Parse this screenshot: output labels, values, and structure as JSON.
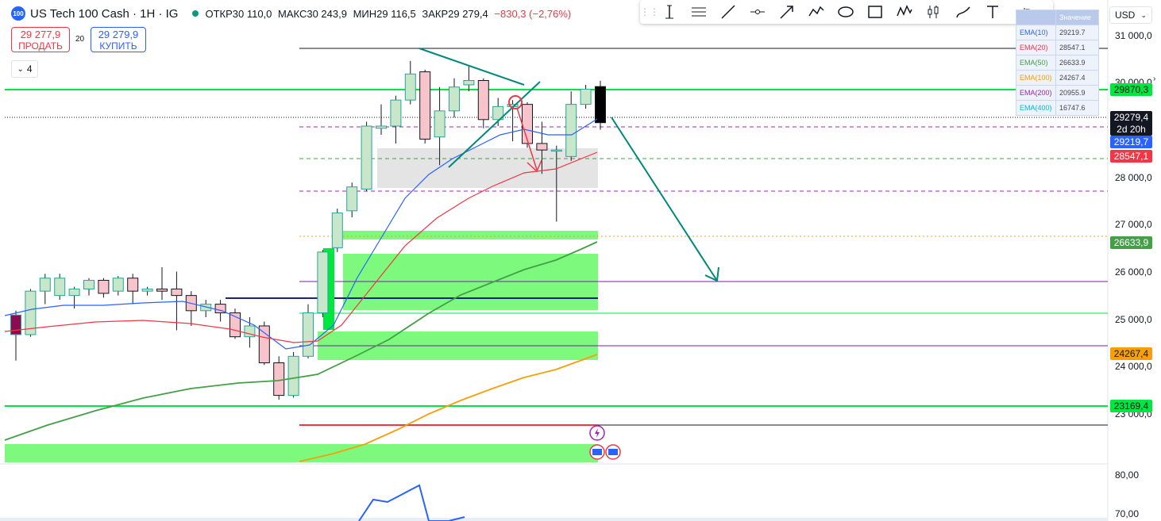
{
  "header": {
    "logo_text": "100",
    "symbol_title": "US Tech 100 Cash · 1H · IG",
    "open": "ОТКР30 110,0",
    "high": "МАКС30 243,9",
    "low": "МИН29 116,5",
    "close": "ЗАКР29 279,4",
    "change": "−830,3 (−2,76%)"
  },
  "trade": {
    "sell_price": "29 277,9",
    "sell_label": "ПРОДАТЬ",
    "spread": "20",
    "buy_price": "29 279,9",
    "buy_label": "КУПИТЬ"
  },
  "indicators_toggle": {
    "label": "4"
  },
  "currency": {
    "label": "USD"
  },
  "ema_table": {
    "header_right": "Значение",
    "rows": [
      {
        "name": "EMA(10)",
        "value": "29219.7",
        "color": "#2962ff"
      },
      {
        "name": "EMA(20)",
        "value": "28547.1",
        "color": "#f23645"
      },
      {
        "name": "EMA(50)",
        "value": "26633.9",
        "color": "#43a047"
      },
      {
        "name": "EMA(100)",
        "value": "24267.4",
        "color": "#f5a00a"
      },
      {
        "name": "EMA(200)",
        "value": "20955.9",
        "color": "#9c27b0"
      },
      {
        "name": "EMA(400)",
        "value": "16747.6",
        "color": "#00bcd4"
      }
    ]
  },
  "price_axis": {
    "labels": [
      "31 000,0",
      "30 000,0",
      "28 000,0",
      "27 000,0",
      "26 000,0",
      "25 000,0",
      "24 000,0",
      "23 000,0"
    ],
    "osc_labels": [
      "80,00",
      "70,00"
    ]
  },
  "price_tags": [
    {
      "text": "29870,3",
      "bg": "#00e640",
      "fg": "#131722"
    },
    {
      "text": "29279,4",
      "bg": "#131722",
      "fg": "#ffffff"
    },
    {
      "text": "2d 20h",
      "bg": "#131722",
      "fg": "#ffffff"
    },
    {
      "text": "29219,7",
      "bg": "#2962ff",
      "fg": "#ffffff"
    },
    {
      "text": "28547,1",
      "bg": "#f23645",
      "fg": "#ffffff"
    },
    {
      "text": "26633,9",
      "bg": "#43a047",
      "fg": "#ffffff"
    },
    {
      "text": "24267,4",
      "bg": "#f5a00a",
      "fg": "#131722"
    },
    {
      "text": "23169,4",
      "bg": "#00e640",
      "fg": "#131722"
    }
  ],
  "toolbar": {
    "tools": [
      "vertical-line-icon",
      "horizontal-lines-icon",
      "trend-line-icon",
      "horizontal-ray-icon",
      "arrow-icon",
      "polyline-icon",
      "ellipse-icon",
      "rectangle-icon",
      "pattern-icon",
      "fib-icon",
      "brush-icon",
      "text-icon",
      "more-icon"
    ]
  },
  "chart_data": {
    "type": "candlestick",
    "y_axis": {
      "min": 22500,
      "max": 31300
    },
    "candles": [
      {
        "o": 24400,
        "c": 24850,
        "h": 24950,
        "l": 23800
      },
      {
        "o": 24400,
        "c": 25400,
        "h": 25450,
        "l": 24350
      },
      {
        "o": 25400,
        "c": 25700,
        "h": 25800,
        "l": 25100
      },
      {
        "o": 25300,
        "c": 25700,
        "h": 25800,
        "l": 25200
      },
      {
        "o": 25300,
        "c": 25450,
        "h": 25500,
        "l": 25000
      },
      {
        "o": 25450,
        "c": 25650,
        "h": 25700,
        "l": 25300
      },
      {
        "o": 25650,
        "c": 25350,
        "h": 25700,
        "l": 25250
      },
      {
        "o": 25400,
        "c": 25700,
        "h": 25750,
        "l": 25300
      },
      {
        "o": 25700,
        "c": 25400,
        "h": 25800,
        "l": 25100
      },
      {
        "o": 25400,
        "c": 25450,
        "h": 25500,
        "l": 25300
      },
      {
        "o": 25450,
        "c": 25400,
        "h": 25950,
        "l": 25200
      },
      {
        "o": 25450,
        "c": 25300,
        "h": 25850,
        "l": 24500
      },
      {
        "o": 25300,
        "c": 24950,
        "h": 25400,
        "l": 24600
      },
      {
        "o": 24950,
        "c": 25100,
        "h": 25200,
        "l": 24800
      },
      {
        "o": 25100,
        "c": 24900,
        "h": 25200,
        "l": 24700
      },
      {
        "o": 24900,
        "c": 24350,
        "h": 25000,
        "l": 24300
      },
      {
        "o": 24350,
        "c": 24600,
        "h": 24800,
        "l": 24100
      },
      {
        "o": 24600,
        "c": 23750,
        "h": 24700,
        "l": 23700
      },
      {
        "o": 23750,
        "c": 23000,
        "h": 23900,
        "l": 22900
      },
      {
        "o": 23000,
        "c": 23900,
        "h": 24000,
        "l": 22950
      },
      {
        "o": 23900,
        "c": 24900,
        "h": 25100,
        "l": 23850
      },
      {
        "o": 24900,
        "c": 26300,
        "h": 26350,
        "l": 24800
      },
      {
        "o": 26400,
        "c": 27200,
        "h": 27300,
        "l": 26300
      },
      {
        "o": 27250,
        "c": 27800,
        "h": 27900,
        "l": 27100
      },
      {
        "o": 27750,
        "c": 29200,
        "h": 29300,
        "l": 27700
      },
      {
        "o": 29150,
        "c": 29200,
        "h": 29700,
        "l": 29000
      },
      {
        "o": 29200,
        "c": 29800,
        "h": 29900,
        "l": 28800
      },
      {
        "o": 29800,
        "c": 30400,
        "h": 30700,
        "l": 29700
      },
      {
        "o": 30450,
        "c": 28900,
        "h": 30500,
        "l": 28800
      },
      {
        "o": 28950,
        "c": 29550,
        "h": 30100,
        "l": 28300
      },
      {
        "o": 29550,
        "c": 30100,
        "h": 30300,
        "l": 29400
      },
      {
        "o": 30150,
        "c": 30250,
        "h": 30600,
        "l": 30000
      },
      {
        "o": 30250,
        "c": 29350,
        "h": 30300,
        "l": 29150
      },
      {
        "o": 29350,
        "c": 29650,
        "h": 29850,
        "l": 29200
      },
      {
        "o": 29650,
        "c": 29700,
        "h": 29800,
        "l": 28850
      },
      {
        "o": 29700,
        "c": 28800,
        "h": 29750,
        "l": 28700
      },
      {
        "o": 28800,
        "c": 28650,
        "h": 29300,
        "l": 28100
      },
      {
        "o": 28650,
        "c": 28650,
        "h": 28750,
        "l": 27000
      },
      {
        "o": 28500,
        "c": 29700,
        "h": 30000,
        "l": 28400
      },
      {
        "o": 29700,
        "c": 30050,
        "h": 30150,
        "l": 29600
      },
      {
        "o": 30110,
        "c": 29279,
        "h": 30243,
        "l": 29116
      }
    ]
  }
}
